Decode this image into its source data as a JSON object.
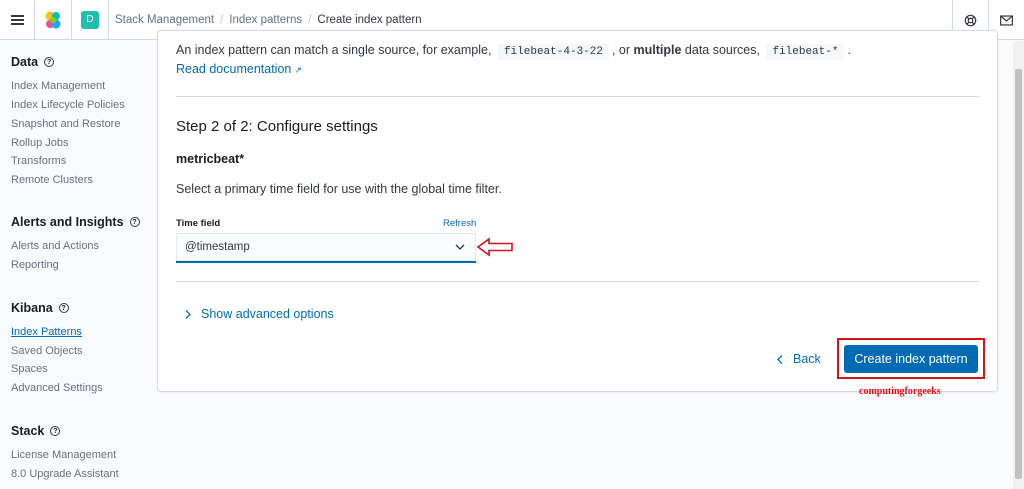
{
  "header": {
    "space_initial": "D",
    "breadcrumbs": [
      "Stack Management",
      "Index patterns",
      "Create index pattern"
    ]
  },
  "sidebar": {
    "sections": [
      {
        "title": "Data",
        "items": [
          "Index Management",
          "Index Lifecycle Policies",
          "Snapshot and Restore",
          "Rollup Jobs",
          "Transforms",
          "Remote Clusters"
        ]
      },
      {
        "title": "Alerts and Insights",
        "items": [
          "Alerts and Actions",
          "Reporting"
        ]
      },
      {
        "title": "Kibana",
        "items": [
          "Index Patterns",
          "Saved Objects",
          "Spaces",
          "Advanced Settings"
        ]
      },
      {
        "title": "Stack",
        "items": [
          "License Management",
          "8.0 Upgrade Assistant"
        ]
      }
    ],
    "active_item": "Index Patterns"
  },
  "main": {
    "intro_prefix": "An index pattern can match a single source, for example,",
    "intro_code1": "filebeat-4-3-22",
    "intro_mid": ", or",
    "intro_bold": "multiple",
    "intro_after": "data sources,",
    "intro_code2": "filebeat-*",
    "intro_end": ".",
    "read_doc": "Read documentation",
    "step_title": "Step 2 of 2: Configure settings",
    "pattern_name": "metricbeat*",
    "description": "Select a primary time field for use with the global time filter.",
    "time_field_label": "Time field",
    "refresh_label": "Refresh",
    "time_field_value": "@timestamp",
    "advanced_label": "Show advanced options",
    "back_label": "Back",
    "create_label": "Create index pattern"
  },
  "watermark": "computingforgeeks",
  "colors": {
    "link": "#006bb4",
    "primary_button": "#006bb4",
    "annotation_red": "#d0141b",
    "space_badge": "#1ebfae"
  },
  "icons": [
    "menu-icon",
    "elastic-logo-icon",
    "help-icon",
    "mail-icon",
    "external-link-icon",
    "chevron-down-icon",
    "chevron-right-icon",
    "chevron-left-icon",
    "annotation-arrow-icon"
  ]
}
